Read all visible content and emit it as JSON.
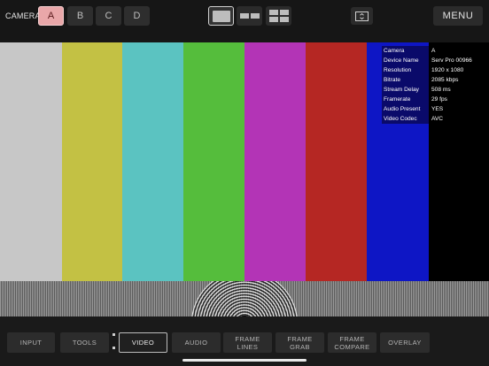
{
  "header": {
    "camera_label": "CAMERA",
    "cameras": [
      "A",
      "B",
      "C",
      "D"
    ],
    "active_camera": "A",
    "menu_label": "MENU"
  },
  "video": {
    "color_bars": [
      "#c7c7c7",
      "#c3c144",
      "#5bc3c1",
      "#55bd3c",
      "#b334b6",
      "#b52723",
      "#0e16c5",
      "#000000"
    ],
    "info": [
      {
        "key": "Camera",
        "value": "A"
      },
      {
        "key": "Device Name",
        "value": "Serv Pro 00966"
      },
      {
        "key": "Resolution",
        "value": "1920 x 1080"
      },
      {
        "key": "Bitrate",
        "value": "2085 kbps"
      },
      {
        "key": "Stream Delay",
        "value": "508 ms"
      },
      {
        "key": "Framerate",
        "value": "29 fps"
      },
      {
        "key": "Audio Present",
        "value": "YES"
      },
      {
        "key": "Video Codec",
        "value": "AVC"
      }
    ]
  },
  "tabs": [
    {
      "label": "INPUT",
      "label2": ""
    },
    {
      "label": "TOOLS",
      "label2": ""
    },
    {
      "label": "VIDEO",
      "label2": ""
    },
    {
      "label": "AUDIO",
      "label2": ""
    },
    {
      "label": "FRAME",
      "label2": "LINES"
    },
    {
      "label": "FRAME",
      "label2": "GRAB"
    },
    {
      "label": "FRAME",
      "label2": "COMPARE"
    },
    {
      "label": "OVERLAY",
      "label2": ""
    }
  ],
  "active_tab": "VIDEO",
  "icons": {
    "single_view": "single-view-icon",
    "dual_view": "dual-view-icon",
    "quad_view": "quad-view-icon",
    "fullscreen": "fullscreen-icon"
  }
}
